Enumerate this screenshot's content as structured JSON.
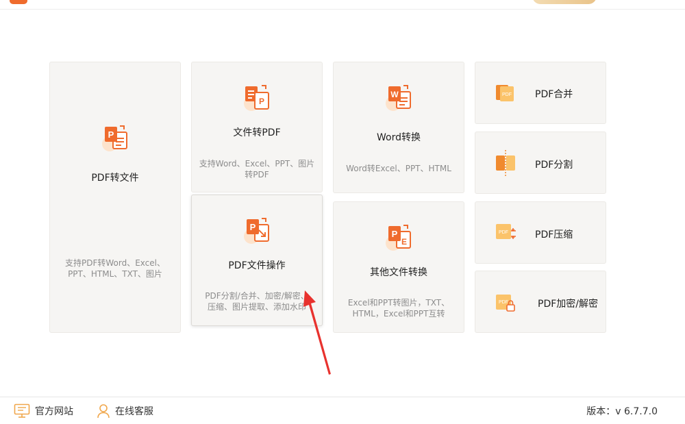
{
  "cards": {
    "pdf_to_file": {
      "title": "PDF转文件",
      "desc": "支持PDF转Word、Excel、PPT、HTML、TXT、图片"
    },
    "file_to_pdf": {
      "title": "文件转PDF",
      "desc": "支持Word、Excel、PPT、图片转PDF"
    },
    "word_convert": {
      "title": "Word转换",
      "desc": "Word转Excel、PPT、HTML"
    },
    "pdf_ops": {
      "title": "PDF文件操作",
      "desc": "PDF分割/合并、加密/解密、压缩、图片提取、添加水印"
    },
    "other_convert": {
      "title": "其他文件转换",
      "desc": "Excel和PPT转图片，TXT、HTML，Excel和PPT互转"
    },
    "pdf_merge": {
      "title": "PDF合并"
    },
    "pdf_split": {
      "title": "PDF分割"
    },
    "pdf_compress": {
      "title": "PDF压缩"
    },
    "pdf_encrypt": {
      "title": "PDF加密/解密"
    }
  },
  "icons": {
    "pdf_to_file": "pdf-to-file-icon",
    "file_to_pdf": "file-to-pdf-icon",
    "word_convert": "word-convert-icon",
    "pdf_ops": "pdf-operation-icon",
    "other_convert": "other-file-convert-icon",
    "pdf_merge": "pdf-merge-icon",
    "pdf_split": "pdf-split-icon",
    "pdf_compress": "pdf-compress-icon",
    "pdf_encrypt": "pdf-encrypt-icon",
    "pdf_badge": "PDF",
    "letter_p": "P",
    "letter_w": "W",
    "letter_e": "E"
  },
  "footer": {
    "website_label": "官方网站",
    "support_label": "在线客服",
    "version_text": "版本：v 6.7.7.0"
  },
  "colors": {
    "accent": "#ef6b2d",
    "accent_light": "#f9a15a",
    "card_bg": "#f6f5f3",
    "annotation_arrow": "#e8322e"
  }
}
